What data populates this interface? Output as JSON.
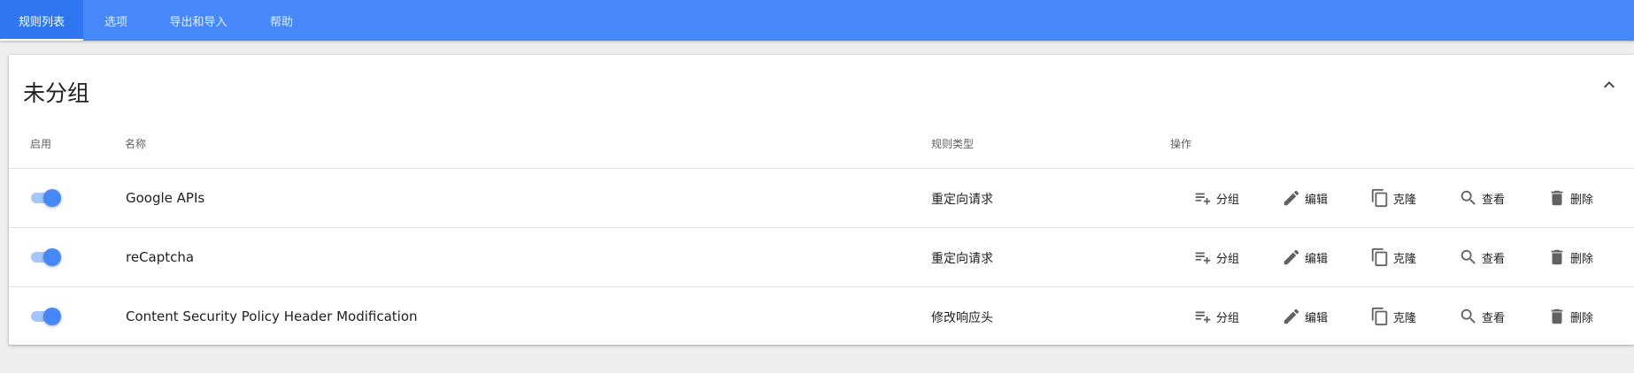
{
  "tabs": [
    {
      "label": "规则列表",
      "active": true
    },
    {
      "label": "选项",
      "active": false
    },
    {
      "label": "导出和导入",
      "active": false
    },
    {
      "label": "帮助",
      "active": false
    }
  ],
  "group": {
    "title": "未分组",
    "collapse_icon": "chevron-up-icon"
  },
  "columns": {
    "enable": "启用",
    "name": "名称",
    "type": "规则类型",
    "actions": "操作"
  },
  "actions": [
    {
      "label": "分组",
      "icon": "playlist-add-icon"
    },
    {
      "label": "编辑",
      "icon": "pencil-icon"
    },
    {
      "label": "克隆",
      "icon": "copy-icon"
    },
    {
      "label": "查看",
      "icon": "search-icon"
    },
    {
      "label": "删除",
      "icon": "trash-icon"
    }
  ],
  "rules": [
    {
      "enabled": true,
      "name": "Google APIs",
      "type": "重定向请求"
    },
    {
      "enabled": true,
      "name": "reCaptcha",
      "type": "重定向请求"
    },
    {
      "enabled": true,
      "name": "Content Security Policy Header Modification",
      "type": "修改响应头"
    }
  ],
  "colors": {
    "accent": "#4688f8",
    "accent_active_tab": "#2f76f0",
    "toggle_track": "#a5c6fb",
    "background": "#eeeeee"
  }
}
